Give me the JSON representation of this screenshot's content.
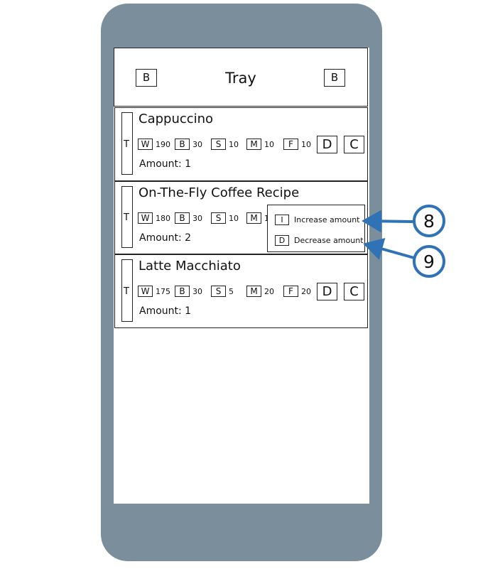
{
  "header": {
    "title": "Tray",
    "left_button": "B",
    "right_button": "B"
  },
  "items": [
    {
      "name": "Cappuccino",
      "t": "T",
      "w": {
        "label": "W",
        "value": "190"
      },
      "b": {
        "label": "B",
        "value": "30"
      },
      "s": {
        "label": "S",
        "value": "10"
      },
      "m": {
        "label": "M",
        "value": "10"
      },
      "f": {
        "label": "F",
        "value": "10"
      },
      "amount": "Amount: 1",
      "d": "D",
      "c": "C"
    },
    {
      "name": "On-The-Fly Coffee Recipe",
      "t": "T",
      "w": {
        "label": "W",
        "value": "180"
      },
      "b": {
        "label": "B",
        "value": "30"
      },
      "s": {
        "label": "S",
        "value": "10"
      },
      "m": {
        "label": "M",
        "value": "1"
      },
      "amount": "Amount: 2"
    },
    {
      "name": "Latte Macchiato",
      "t": "T",
      "w": {
        "label": "W",
        "value": "175"
      },
      "b": {
        "label": "B",
        "value": "30"
      },
      "s": {
        "label": "S",
        "value": "5"
      },
      "m": {
        "label": "M",
        "value": "20"
      },
      "f": {
        "label": "F",
        "value": "20"
      },
      "amount": "Amount: 1",
      "d": "D",
      "c": "C"
    }
  ],
  "popup": {
    "increase": {
      "key": "I",
      "label": "Increase amount"
    },
    "decrease": {
      "key": "D",
      "label": "Decrease amount"
    }
  },
  "callouts": [
    "8",
    "9"
  ],
  "colors": {
    "phone": "#7a8f9b",
    "callout": "#2f72b6"
  }
}
